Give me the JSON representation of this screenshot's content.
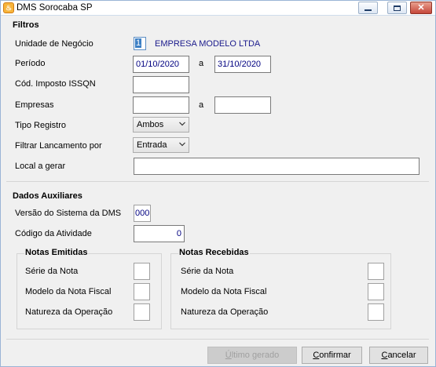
{
  "window": {
    "title": "DMS Sorocaba SP",
    "app_icon_glyph": "♨"
  },
  "filtros": {
    "title": "Filtros",
    "unidade_label": "Unidade de Negócio",
    "unidade_code": "1",
    "unidade_name": "EMPRESA MODELO LTDA",
    "periodo_label": "Período",
    "periodo_start": "01/10/2020",
    "periodo_sep": "a",
    "periodo_end": "31/10/2020",
    "cod_imposto_label": "Cód. Imposto ISSQN",
    "cod_imposto_value": "",
    "empresas_label": "Empresas",
    "empresas_start": "",
    "empresas_sep": "a",
    "empresas_end": "",
    "tipo_registro_label": "Tipo Registro",
    "tipo_registro_value": "Ambos",
    "filtrar_label": "Filtrar Lancamento por",
    "filtrar_value": "Entrada",
    "local_label": "Local a gerar",
    "local_value": ""
  },
  "auxiliares": {
    "title": "Dados Auxiliares",
    "versao_label": "Versão do Sistema da DMS",
    "versao_value": "000",
    "codigo_label": "Código da Atividade",
    "codigo_value": "0",
    "emitidas": {
      "title": "Notas Emitidas",
      "serie_label": "Série da Nota",
      "modelo_label": "Modelo da Nota Fiscal",
      "natureza_label": "Natureza da Operação"
    },
    "recebidas": {
      "title": "Notas Recebidas",
      "serie_label": "Série da Nota",
      "modelo_label": "Modelo da Nota Fiscal",
      "natureza_label": "Natureza da Operação"
    }
  },
  "buttons": {
    "ultimo_first": "Ú",
    "ultimo_rest": "ltimo gerado",
    "confirmar_first": "C",
    "confirmar_rest": "onfirmar",
    "cancelar_first": "C",
    "cancelar_rest": "ancelar"
  }
}
